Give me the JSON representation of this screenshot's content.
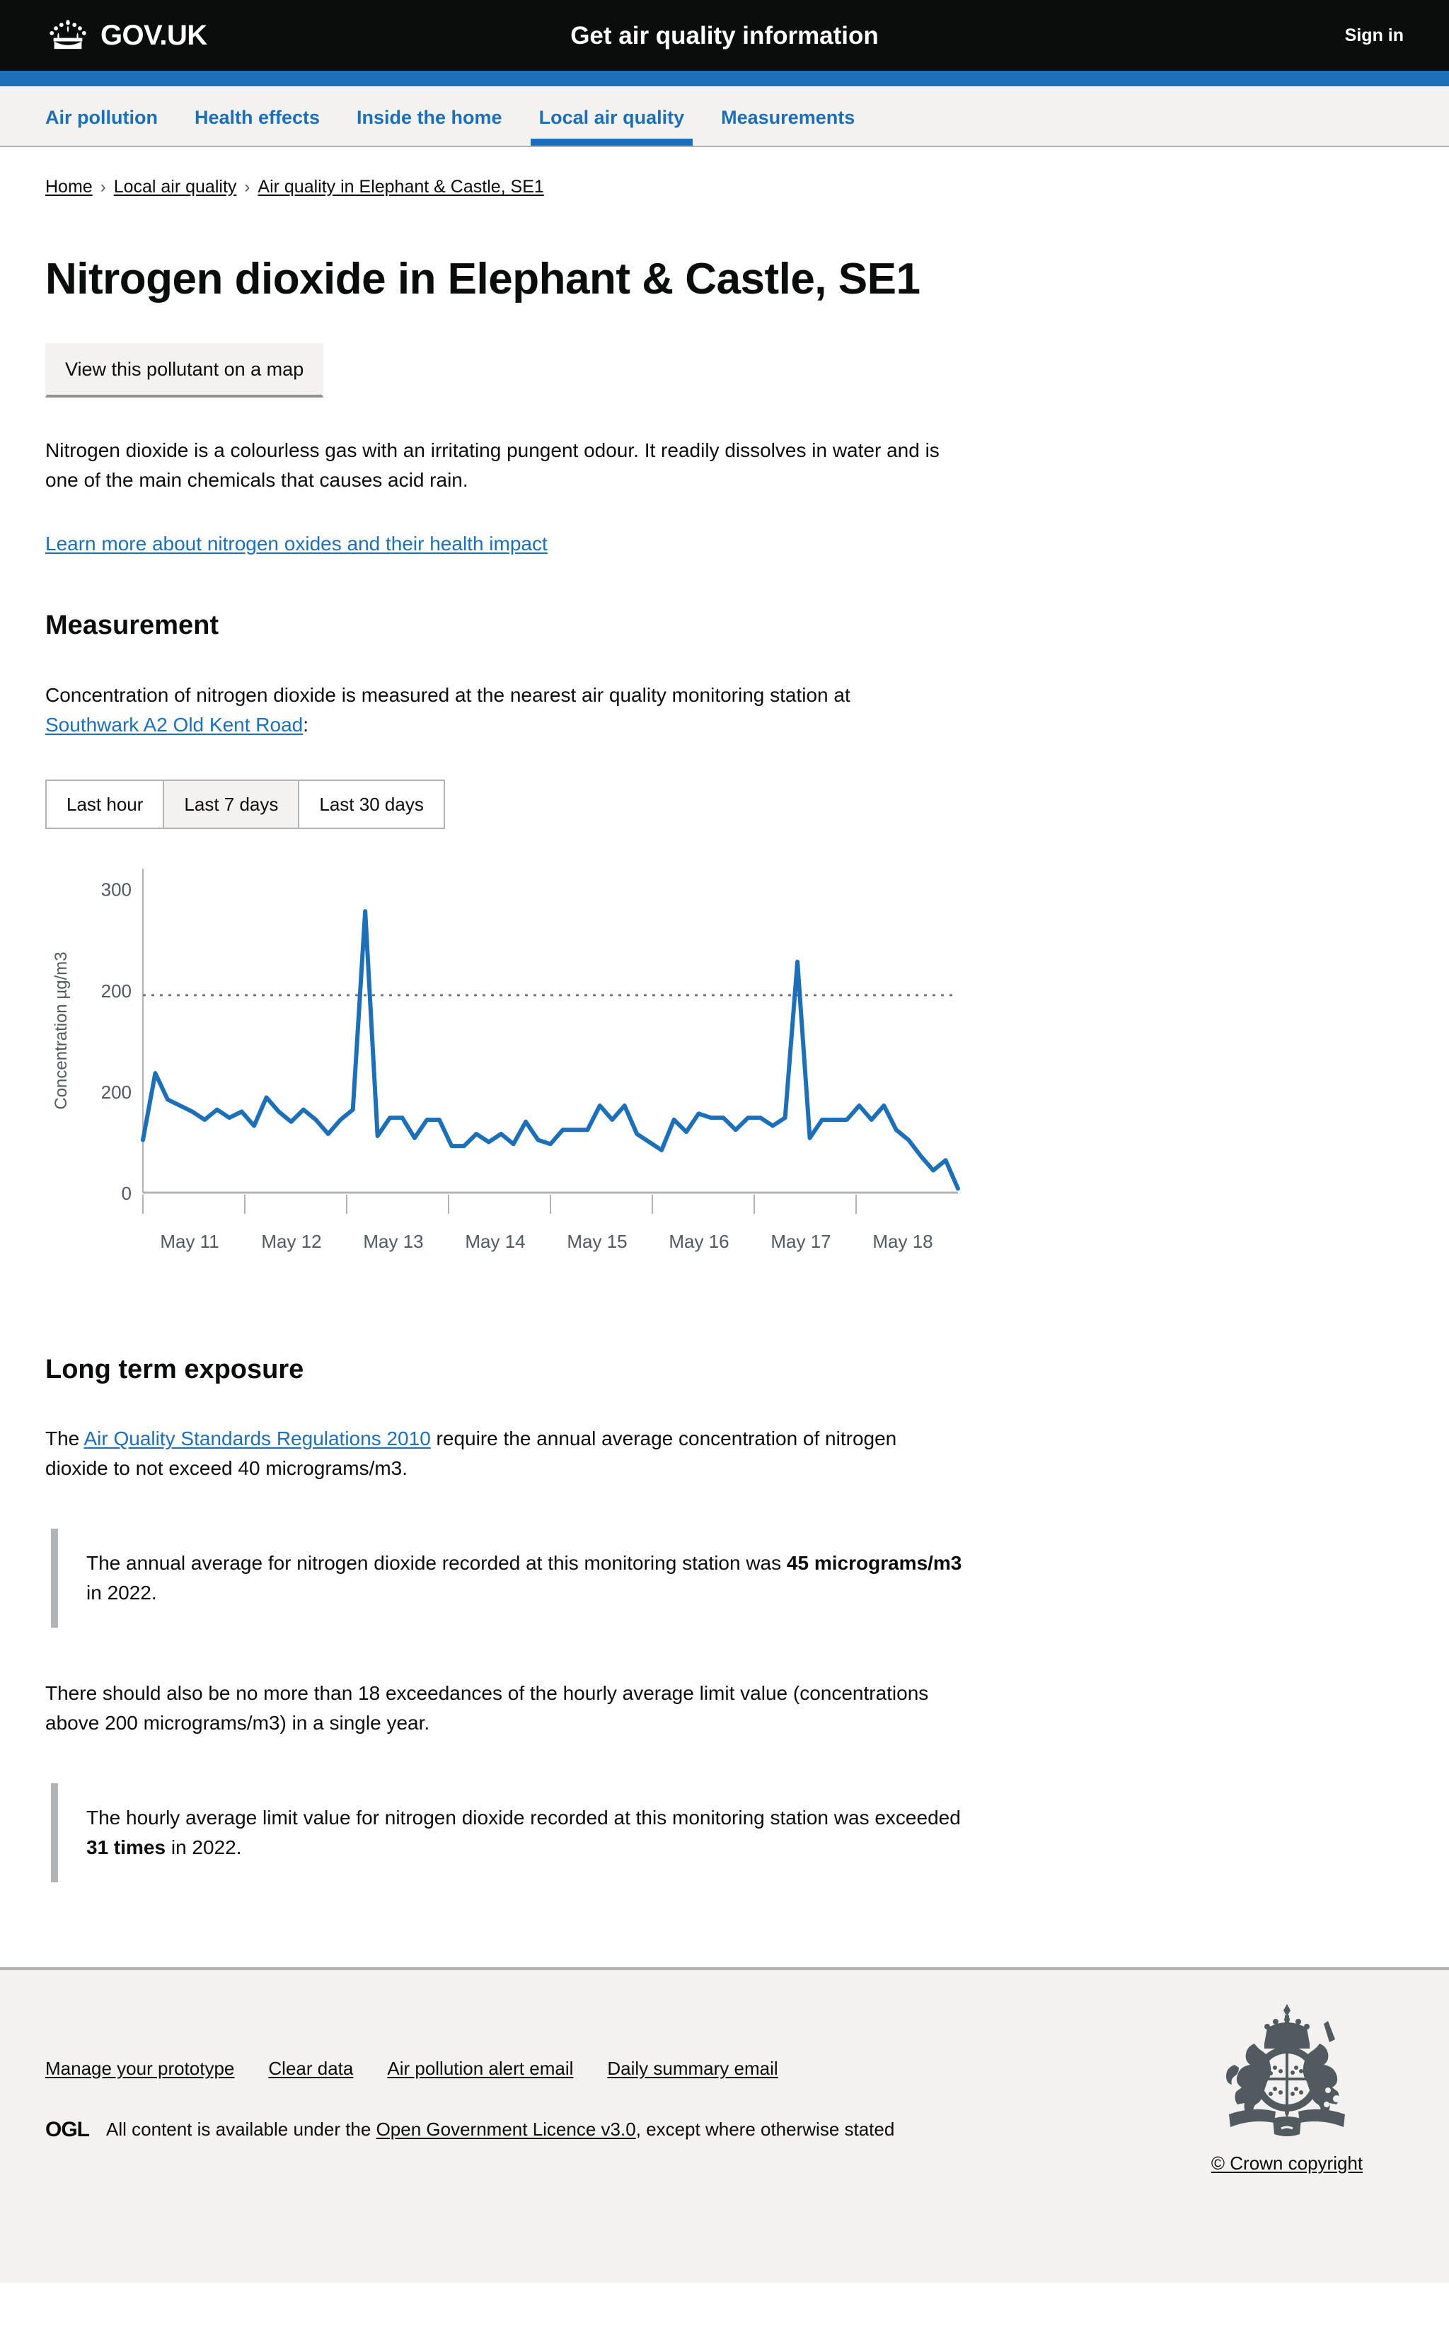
{
  "header": {
    "brand": "GOV.UK",
    "service_name": "Get air quality information",
    "signin_label": "Sign in",
    "crown_icon": "crown-icon"
  },
  "nav": {
    "items": [
      {
        "label": "Air pollution",
        "active": false
      },
      {
        "label": "Health effects",
        "active": false
      },
      {
        "label": "Inside the home",
        "active": false
      },
      {
        "label": "Local air quality",
        "active": true
      },
      {
        "label": "Measurements",
        "active": false
      }
    ]
  },
  "breadcrumb": {
    "items": [
      "Home",
      "Local air quality",
      "Air quality in Elephant & Castle, SE1"
    ],
    "separator": "›"
  },
  "main": {
    "page_title": "Nitrogen dioxide in Elephant & Castle, SE1",
    "map_button_label": "View this pollutant on a map",
    "intro_paragraph": "Nitrogen dioxide is a colourless gas with an irritating pungent odour. It readily dissolves in water and is one of the main chemicals that causes acid rain.",
    "learn_more_link": "Learn more about nitrogen oxides and their health impact",
    "measurement_heading": "Measurement",
    "measurement_text_before": "Concentration of nitrogen dioxide is measured at the nearest air quality monitoring station at ",
    "station_link": "Southwark A2 Old Kent Road",
    "measurement_text_after": ":",
    "tabs": [
      {
        "label": "Last hour",
        "selected": false
      },
      {
        "label": "Last 7 days",
        "selected": true
      },
      {
        "label": "Last 30 days",
        "selected": false
      }
    ],
    "long_term_heading": "Long term exposure",
    "regulation_text_before": "The ",
    "regulation_link": "Air Quality Standards Regulations 2010",
    "regulation_text_after": " require the annual average concentration of nitrogen dioxide to not exceed 40 micrograms/m3.",
    "inset_annual_before": "The annual average for nitrogen dioxide recorded at this monitoring station was ",
    "inset_annual_strong": "45 micrograms/m3",
    "inset_annual_after": " in 2022.",
    "exceedance_text": "There should also be no more than 18 exceedances of the hourly average limit value (concentrations above 200 micrograms/m3) in a single year.",
    "inset_hourly_before": "The hourly average limit value for nitrogen dioxide recorded at this monitoring station was exceeded ",
    "inset_hourly_strong": "31 times",
    "inset_hourly_after": " in 2022."
  },
  "chart_data": {
    "type": "line",
    "title": "",
    "xlabel": "",
    "ylabel": "Concentration µg/m3",
    "ytick_labels": [
      "300",
      "200",
      "200",
      "0"
    ],
    "ytick_values": [
      300,
      200,
      100,
      0
    ],
    "ylim": [
      0,
      320
    ],
    "xtick_labels": [
      "May 11",
      "May 12",
      "May 13",
      "May 14",
      "May 15",
      "May 16",
      "May 17",
      "May 18"
    ],
    "grid": false,
    "legend": "none",
    "line_color": "#1d70b8",
    "threshold": {
      "value": 195,
      "label": "",
      "style": "dotted",
      "color": "#6f777b"
    },
    "series": [
      {
        "name": "Nitrogen dioxide",
        "values": [
          52,
          118,
          92,
          86,
          80,
          72,
          82,
          74,
          80,
          66,
          94,
          80,
          70,
          82,
          72,
          58,
          72,
          82,
          278,
          56,
          74,
          74,
          54,
          72,
          72,
          46,
          46,
          58,
          50,
          58,
          48,
          70,
          52,
          48,
          62,
          62,
          62,
          86,
          72,
          86,
          58,
          50,
          42,
          72,
          60,
          78,
          74,
          74,
          62,
          74,
          74,
          66,
          74,
          228,
          54,
          72,
          72,
          72,
          86,
          72,
          86,
          62,
          52,
          36,
          22,
          32,
          4
        ]
      }
    ]
  },
  "footer": {
    "links": [
      "Manage your prototype",
      "Clear data",
      "Air pollution alert email",
      "Daily summary email"
    ],
    "ogl_logo": "OGL",
    "licence_before": "All content is available under the ",
    "licence_link": "Open Government Licence v3.0",
    "licence_after": ", except where otherwise stated",
    "crown_copyright": "© Crown copyright",
    "crest_icon": "royal-coat-of-arms-icon"
  }
}
